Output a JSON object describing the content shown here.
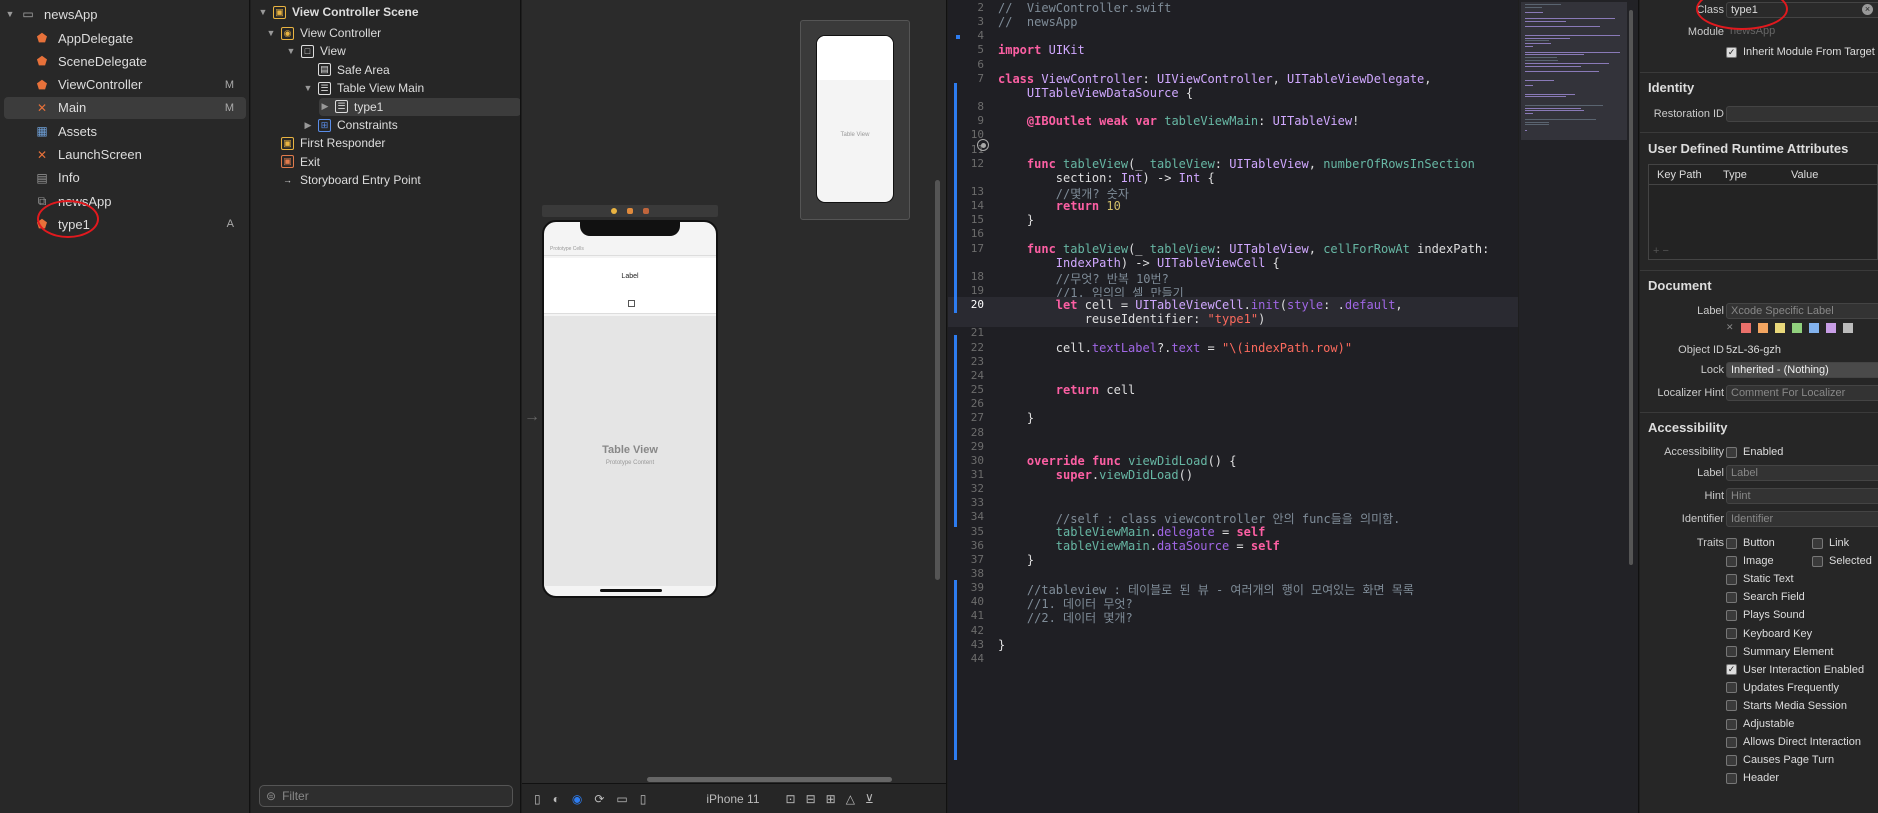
{
  "navigator": {
    "project": "newsApp",
    "items": [
      {
        "label": "AppDelegate",
        "icon": "swift-icon",
        "badge": ""
      },
      {
        "label": "SceneDelegate",
        "icon": "swift-icon",
        "badge": ""
      },
      {
        "label": "ViewController",
        "icon": "swift-icon",
        "badge": "M"
      },
      {
        "label": "Main",
        "icon": "storyboard-icon",
        "badge": "M"
      },
      {
        "label": "Assets",
        "icon": "assets-icon",
        "badge": ""
      },
      {
        "label": "LaunchScreen",
        "icon": "storyboard-icon",
        "badge": ""
      },
      {
        "label": "Info",
        "icon": "plist-icon",
        "badge": ""
      },
      {
        "label": "newsApp",
        "icon": "folder-icon",
        "badge": ""
      },
      {
        "label": "type1",
        "icon": "swift-icon",
        "badge": "A"
      }
    ]
  },
  "outline": {
    "scene": "View Controller Scene",
    "items": [
      "View Controller",
      "View",
      "Safe Area",
      "Table View Main",
      "type1",
      "Constraints",
      "First Responder",
      "Exit",
      "Storyboard Entry Point"
    ],
    "filter_placeholder": "Filter"
  },
  "canvas": {
    "prototype_cells": "Prototype Cells",
    "cell_label": "Label",
    "table_view": "Table View",
    "prototype_content": "Prototype Content",
    "device": "iPhone 11",
    "small_table_view": "Table View"
  },
  "code": {
    "lines": [
      {
        "n": "2",
        "t": "//  ViewController.swift"
      },
      {
        "n": "3",
        "t": "//  newsApp"
      },
      {
        "n": "4",
        "t": ""
      },
      {
        "n": "5",
        "t": "import UIKit"
      },
      {
        "n": "6",
        "t": ""
      },
      {
        "n": "7",
        "t": "class ViewController: UIViewController, UITableViewDelegate,"
      },
      {
        "n": "",
        "t": "    UITableViewDataSource {"
      },
      {
        "n": "8",
        "t": ""
      },
      {
        "n": "9",
        "t": "    @IBOutlet weak var tableViewMain: UITableView!"
      },
      {
        "n": "10",
        "t": ""
      },
      {
        "n": "11",
        "t": ""
      },
      {
        "n": "12",
        "t": "    func tableView(_ tableView: UITableView, numberOfRowsInSection"
      },
      {
        "n": "",
        "t": "        section: Int) -> Int {"
      },
      {
        "n": "13",
        "t": "        //몇개? 숫자"
      },
      {
        "n": "14",
        "t": "        return 10"
      },
      {
        "n": "15",
        "t": "    }"
      },
      {
        "n": "16",
        "t": ""
      },
      {
        "n": "17",
        "t": "    func tableView(_ tableView: UITableView, cellForRowAt indexPath:"
      },
      {
        "n": "",
        "t": "        IndexPath) -> UITableViewCell {"
      },
      {
        "n": "18",
        "t": "        //무엇? 반복 10번?"
      },
      {
        "n": "19",
        "t": "        //1. 임의의 셀 만들기"
      },
      {
        "n": "20",
        "t": "        let cell = UITableViewCell.init(style: .default,"
      },
      {
        "n": "",
        "t": "            reuseIdentifier: \"type1\")"
      },
      {
        "n": "21",
        "t": ""
      },
      {
        "n": "22",
        "t": "        cell.textLabel?.text = \"\\(indexPath.row)\""
      },
      {
        "n": "23",
        "t": ""
      },
      {
        "n": "24",
        "t": ""
      },
      {
        "n": "25",
        "t": "        return cell"
      },
      {
        "n": "26",
        "t": ""
      },
      {
        "n": "27",
        "t": "    }"
      },
      {
        "n": "28",
        "t": ""
      },
      {
        "n": "29",
        "t": ""
      },
      {
        "n": "30",
        "t": "    override func viewDidLoad() {"
      },
      {
        "n": "31",
        "t": "        super.viewDidLoad()"
      },
      {
        "n": "32",
        "t": ""
      },
      {
        "n": "33",
        "t": ""
      },
      {
        "n": "34",
        "t": "        //self : class viewcontroller 안의 func들을 의미함."
      },
      {
        "n": "35",
        "t": "        tableViewMain.delegate = self"
      },
      {
        "n": "36",
        "t": "        tableViewMain.dataSource = self"
      },
      {
        "n": "37",
        "t": "    }"
      },
      {
        "n": "38",
        "t": ""
      },
      {
        "n": "39",
        "t": "    //tableview : 테이블로 된 뷰 - 여러개의 행이 모여있는 화면 목록"
      },
      {
        "n": "40",
        "t": "    //1. 데이터 무엇?"
      },
      {
        "n": "41",
        "t": "    //2. 데이터 몇개?"
      },
      {
        "n": "42",
        "t": ""
      },
      {
        "n": "43",
        "t": "}"
      },
      {
        "n": "44",
        "t": ""
      }
    ]
  },
  "inspector": {
    "class_label": "Class",
    "class_value": "type1",
    "module_label": "Module",
    "module_value": "newsApp",
    "inherit": "Inherit Module From Target",
    "identity": "Identity",
    "restoration_id": "Restoration ID",
    "udra": "User Defined Runtime Attributes",
    "col_key": "Key Path",
    "col_type": "Type",
    "col_value": "Value",
    "document": "Document",
    "doc_label": "Label",
    "doc_label_ph": "Xcode Specific Label",
    "object_id_label": "Object ID",
    "object_id": "5zL-36-gzh",
    "lock_label": "Lock",
    "lock_value": "Inherited - (Nothing)",
    "localizer_label": "Localizer Hint",
    "localizer_ph": "Comment For Localizer",
    "accessibility": "Accessibility",
    "acc_label": "Accessibility",
    "enabled": "Enabled",
    "label_label": "Label",
    "label_ph": "Label",
    "hint_label": "Hint",
    "hint_ph": "Hint",
    "identifier_label": "Identifier",
    "identifier_ph": "Identifier",
    "traits_label": "Traits",
    "traits": [
      {
        "label": "Button",
        "checked": false
      },
      {
        "label": "Image",
        "checked": false
      },
      {
        "label": "Static Text",
        "checked": false
      },
      {
        "label": "Search Field",
        "checked": false
      },
      {
        "label": "Plays Sound",
        "checked": false
      },
      {
        "label": "Keyboard Key",
        "checked": false
      },
      {
        "label": "Summary Element",
        "checked": false
      },
      {
        "label": "User Interaction Enabled",
        "checked": true
      },
      {
        "label": "Updates Frequently",
        "checked": false
      },
      {
        "label": "Starts Media Session",
        "checked": false
      },
      {
        "label": "Adjustable",
        "checked": false
      },
      {
        "label": "Allows Direct Interaction",
        "checked": false
      },
      {
        "label": "Causes Page Turn",
        "checked": false
      },
      {
        "label": "Header",
        "checked": false
      }
    ],
    "traits_right": [
      {
        "label": "Link",
        "checked": false
      },
      {
        "label": "Selected",
        "checked": false
      }
    ]
  },
  "colors": {
    "accent": "#2d7cf0",
    "annotation": "#e1191e",
    "keyword": "#fc5fa3",
    "string": "#fc6a5d",
    "comment": "#7f8c98"
  }
}
